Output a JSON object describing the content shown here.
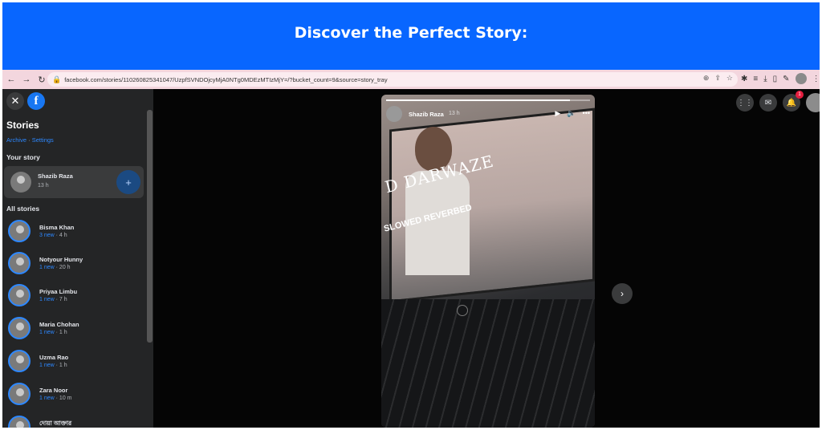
{
  "banner": {
    "title": "Discover the Perfect Story:"
  },
  "browser": {
    "url": "facebook.com/stories/110260825341047/UzpfSVNDOjcyMjA0NTg0MDEzMTIzMjY=/?bucket_count=9&source=story_tray",
    "nav": {
      "back_icon": "←",
      "forward_icon": "→",
      "reload_icon": "↻"
    }
  },
  "sidebar": {
    "stories_title": "Stories",
    "archive_label": "Archive",
    "links_separator": "·",
    "settings_label": "Settings",
    "your_story_heading": "Your story",
    "your_story": {
      "name": "Shazib Raza",
      "time": "13 h"
    },
    "all_stories_heading": "All stories",
    "items": [
      {
        "name": "Bisma Khan",
        "new": "3 new",
        "time": "4 h"
      },
      {
        "name": "Notyour Hunny",
        "new": "1 new",
        "time": "20 h"
      },
      {
        "name": "Priyaa Limbu",
        "new": "1 new",
        "time": "7 h"
      },
      {
        "name": "Maria Chohan",
        "new": "1 new",
        "time": "1 h"
      },
      {
        "name": "Uzma Rao",
        "new": "1 new",
        "time": "1 h"
      },
      {
        "name": "Zara Noor",
        "new": "1 new",
        "time": "10 m"
      },
      {
        "name": "দোয়া আক্তার",
        "new": "",
        "time": ""
      }
    ]
  },
  "viewer": {
    "author": "Shazib Raza",
    "time": "13 h",
    "overlay_title": "D DARWAZE",
    "overlay_subtitle": "SLOWED REVERBED",
    "progress": 0.9
  },
  "topbar": {
    "notification_count": "1"
  },
  "colors": {
    "banner": "#0866ff",
    "accent": "#2d88ff",
    "sidebar_bg": "#242526",
    "badge": "#e41e3f"
  }
}
